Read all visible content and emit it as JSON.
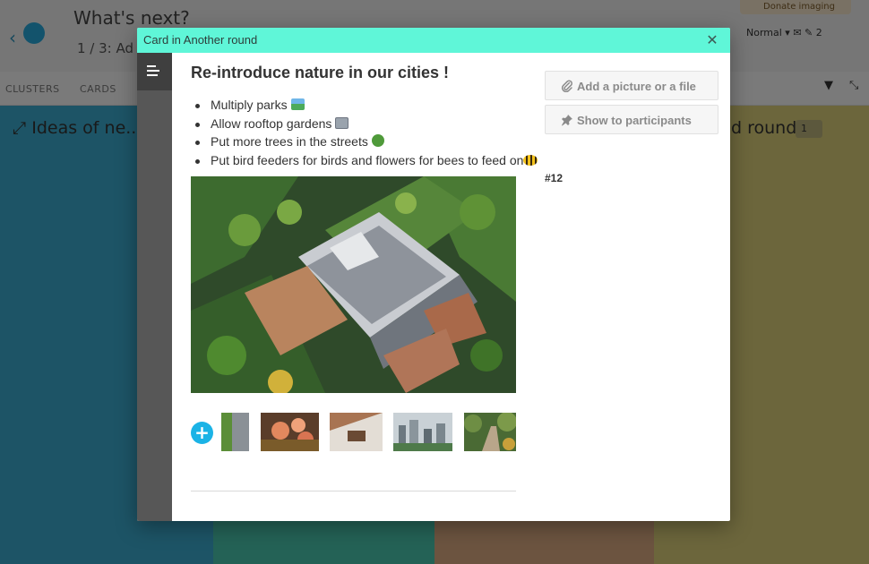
{
  "background": {
    "title": "What's next?",
    "subtitle": "1 / 3: Ad",
    "tabs": [
      "CLUSTERS",
      "CARDS"
    ],
    "column_label_left": "Ideas of ne...",
    "column_label_right": "d round",
    "pill_label": "Donate imaging",
    "zoom_label": "Normal",
    "counter": "2",
    "badge": "1"
  },
  "modal": {
    "title": "Card in Another round",
    "close_label": "✕",
    "card": {
      "title": "Re-introduce nature in our cities !",
      "bullets": [
        {
          "text": "Multiply parks",
          "emoji": "park"
        },
        {
          "text": "Allow rooftop gardens",
          "emoji": "building"
        },
        {
          "text": "Put more trees in the streets",
          "emoji": "tree"
        },
        {
          "text": "Put bird feeders for birds and flowers for bees to feed on",
          "emoji": "bee"
        }
      ],
      "attachments": [
        "green-building",
        "flowers",
        "interior",
        "city-skyline",
        "garden-path"
      ]
    },
    "actions": {
      "add_file_label": "Add a picture or a file",
      "show_label": "Show to participants"
    },
    "card_number": "#12"
  },
  "colors": {
    "header": "#5ff6d8",
    "accent": "#1bb3e6",
    "rail": "#575757"
  }
}
